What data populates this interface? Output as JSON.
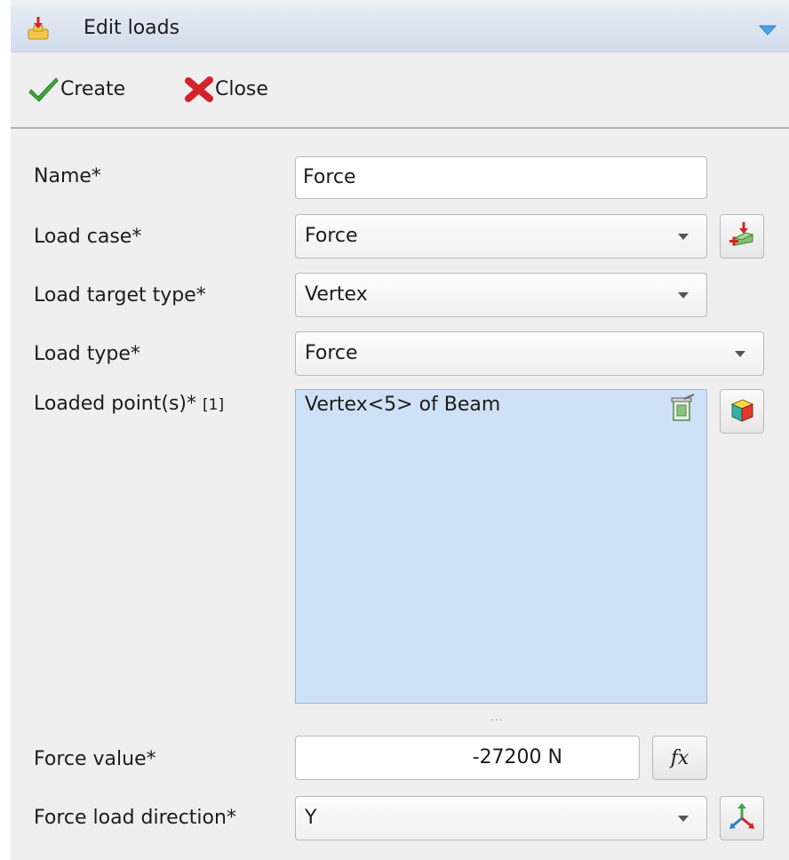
{
  "header": {
    "title": "Edit loads"
  },
  "toolbar": {
    "create_label": "Create",
    "close_label": "Close"
  },
  "form": {
    "name_label": "Name*",
    "name_value": "Force",
    "load_case_label": "Load case*",
    "load_case_value": "Force",
    "target_type_label": "Load target type*",
    "target_type_value": "Vertex",
    "load_type_label": "Load type*",
    "load_type_value": "Force",
    "loaded_points_label": "Loaded point(s)*",
    "loaded_points_count": "[1]",
    "loaded_points": [
      "Vertex<5> of Beam"
    ],
    "resize_grip": "...",
    "force_value_label": "Force value*",
    "force_value": "-27200  N",
    "fx_label": "fx",
    "direction_label": "Force load direction*",
    "direction_value": "Y"
  },
  "icons": {
    "title": "load-arrow-icon",
    "collapse": "triangle-down-icon",
    "create": "checkmark-icon",
    "close": "red-x-icon",
    "add_load_case": "add-load-case-icon",
    "remove_selection": "trash-icon",
    "select_geometry": "cube-select-icon",
    "direction": "axes-icon"
  },
  "colors": {
    "title_bar": "#d2dcec",
    "list_selection": "#cfe1f6",
    "create_green": "#3fa83a",
    "close_red": "#d2232a",
    "collapse_blue": "#4aa3e8"
  }
}
